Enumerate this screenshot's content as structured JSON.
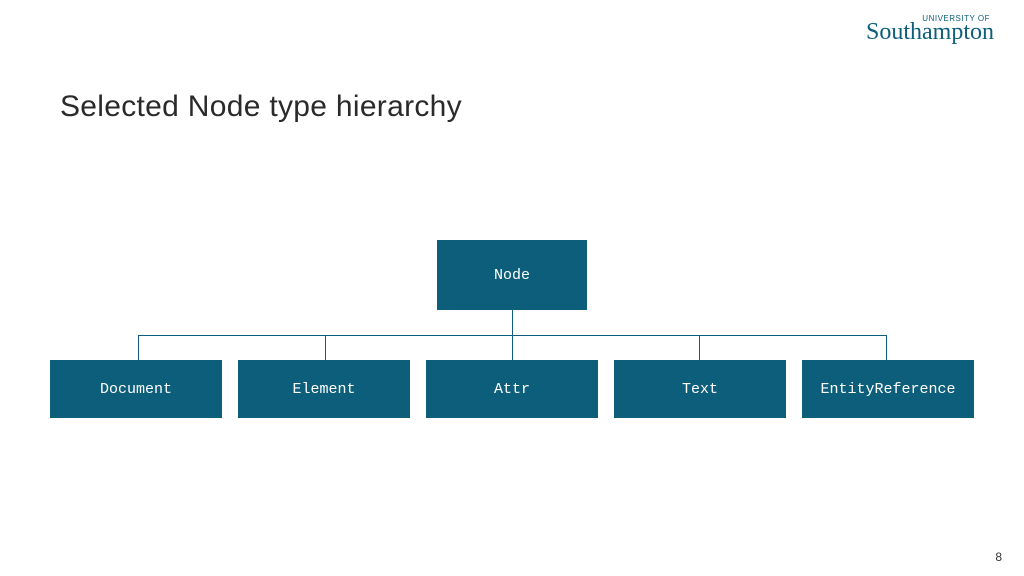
{
  "logo": {
    "superscript": "UNIVERSITY OF",
    "main": "Southampton"
  },
  "title": "Selected Node type hierarchy",
  "diagram": {
    "root": "Node",
    "children": [
      "Document",
      "Element",
      "Attr",
      "Text",
      "EntityReference"
    ]
  },
  "page_number": "8",
  "colors": {
    "brand": "#0d5e7a"
  }
}
